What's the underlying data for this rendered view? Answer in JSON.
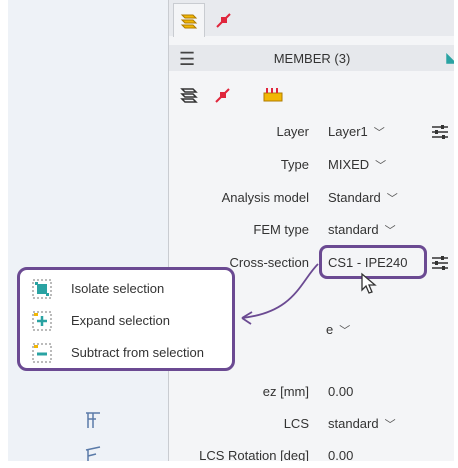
{
  "tabs": [
    {
      "icon": "layers-icon",
      "active": true
    },
    {
      "icon": "member-pin-icon",
      "active": false
    }
  ],
  "header": {
    "menu_icon": "hamburger-icon",
    "title": "MEMBER (3)"
  },
  "toolbar": {
    "buttons": [
      "layers-icon",
      "member-pin-icon",
      "structure-icon"
    ]
  },
  "properties": [
    {
      "label": "Layer",
      "value": "Layer1",
      "dropdown": true,
      "settings": true
    },
    {
      "label": "Type",
      "value": "MIXED",
      "dropdown": true,
      "settings": false
    },
    {
      "label": "Analysis model",
      "value": "Standard",
      "dropdown": true,
      "settings": false
    },
    {
      "label": "FEM type",
      "value": "standard",
      "dropdown": true,
      "settings": false
    },
    {
      "label": "Cross-section",
      "value": "CS1 - IPE240",
      "dropdown": false,
      "settings": true
    },
    {
      "label": "ez [mm]",
      "value": "0.00",
      "dropdown": false,
      "settings": false
    },
    {
      "label": "LCS",
      "value": "standard",
      "dropdown": true,
      "settings": false
    },
    {
      "label": "LCS Rotation [deg]",
      "value": "0.00",
      "dropdown": false,
      "settings": false
    }
  ],
  "partial_row_fragment": "e",
  "context_menu": {
    "items": [
      {
        "label": "Isolate selection",
        "icon": "isolate-selection-icon"
      },
      {
        "label": "Expand selection",
        "icon": "expand-selection-icon"
      },
      {
        "label": "Subtract from selection",
        "icon": "subtract-selection-icon"
      }
    ]
  },
  "colors": {
    "callout": "#6b4a92",
    "mixed": "#3bc0d6",
    "accent_red": "#e0263c",
    "accent_yellow": "#f2b705"
  }
}
